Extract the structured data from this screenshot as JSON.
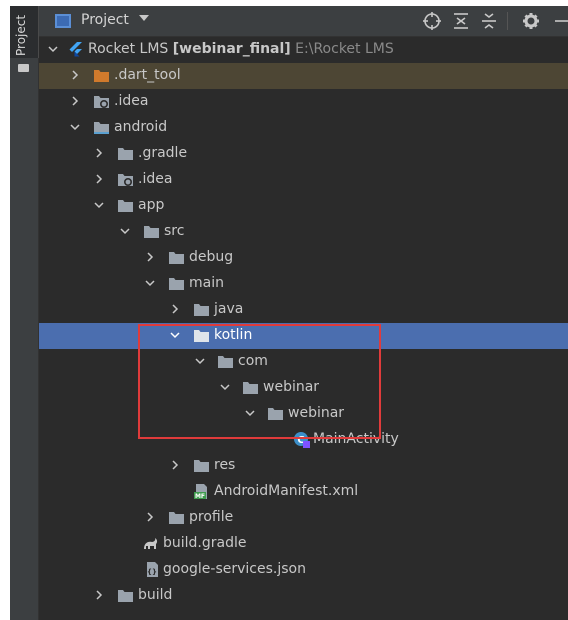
{
  "sidebar": {
    "tab_label": "Project"
  },
  "toolbar": {
    "title": "Project",
    "buttons": [
      "locate-icon",
      "expand-all-icon",
      "collapse-all-icon",
      "gear-icon",
      "minimize-icon"
    ]
  },
  "tree": {
    "root": {
      "name": "Rocket LMS",
      "module": "[webinar_final]",
      "path": "E:\\Rocket LMS"
    },
    "items": [
      {
        "label": ".dart_tool",
        "icon": "folder-orange-icon"
      },
      {
        "label": ".idea",
        "icon": "folder-settings-icon"
      },
      {
        "label": "android",
        "icon": "folder-module-icon"
      },
      {
        "label": ".gradle",
        "icon": "folder-icon"
      },
      {
        "label": ".idea",
        "icon": "folder-settings-icon"
      },
      {
        "label": "app",
        "icon": "folder-icon"
      },
      {
        "label": "src",
        "icon": "folder-icon"
      },
      {
        "label": "debug",
        "icon": "folder-icon"
      },
      {
        "label": "main",
        "icon": "folder-icon"
      },
      {
        "label": "java",
        "icon": "folder-icon"
      },
      {
        "label": "kotlin",
        "icon": "folder-icon"
      },
      {
        "label": "com",
        "icon": "folder-icon"
      },
      {
        "label": "webinar",
        "icon": "folder-icon"
      },
      {
        "label": "webinar",
        "icon": "folder-icon"
      },
      {
        "label": "MainActivity",
        "icon": "kotlin-class-icon"
      },
      {
        "label": "res",
        "icon": "folder-icon"
      },
      {
        "label": "AndroidManifest.xml",
        "icon": "manifest-icon"
      },
      {
        "label": "profile",
        "icon": "folder-icon"
      },
      {
        "label": "build.gradle",
        "icon": "gradle-icon"
      },
      {
        "label": "google-services.json",
        "icon": "json-file-icon"
      },
      {
        "label": "build",
        "icon": "folder-icon"
      }
    ]
  },
  "colors": {
    "background": "#2b2b2b",
    "selection": "#4b6eaf",
    "excluded_row": "#4d4634",
    "highlight_box": "#e03b3b",
    "folder": "#9aa3ad"
  }
}
